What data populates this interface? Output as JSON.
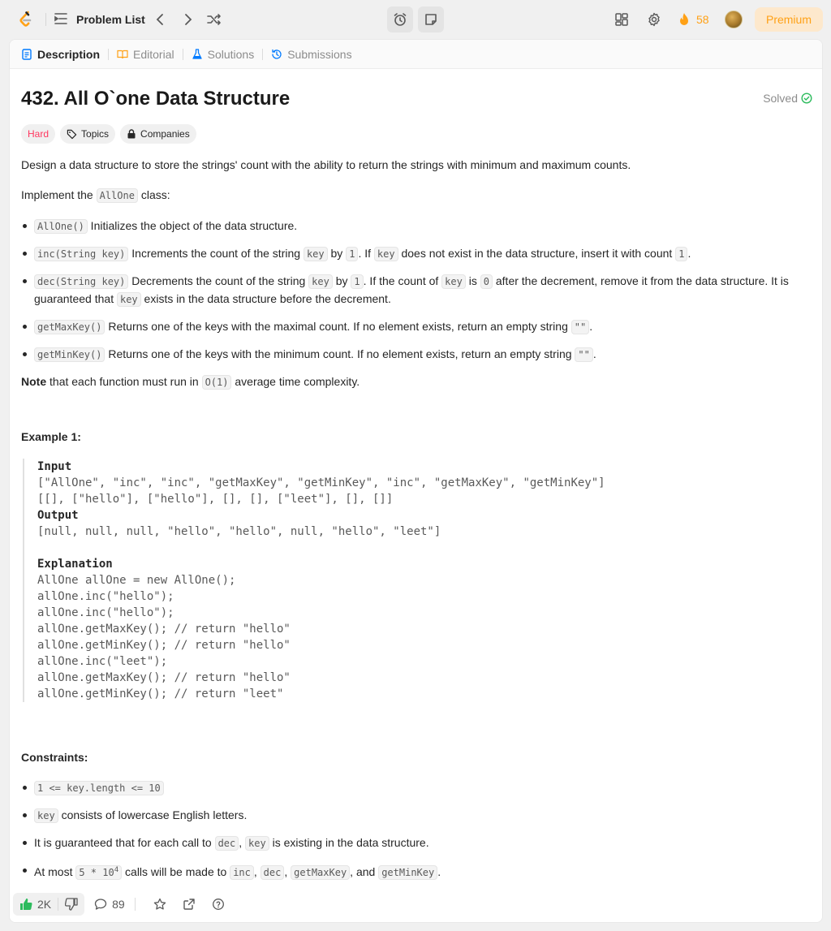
{
  "topbar": {
    "problem_list_label": "Problem List",
    "streak_count": "58",
    "premium_label": "Premium"
  },
  "tabs": [
    {
      "label": "Description"
    },
    {
      "label": "Editorial"
    },
    {
      "label": "Solutions"
    },
    {
      "label": "Submissions"
    }
  ],
  "problem": {
    "title": "432. All O`one Data Structure",
    "status": "Solved",
    "difficulty": "Hard",
    "topics_label": "Topics",
    "companies_label": "Companies",
    "intro": "Design a data structure to store the strings' count with the ability to return the strings with minimum and maximum counts.",
    "implement_prefix": "Implement the ",
    "implement_code": "AllOne",
    "implement_suffix": " class:",
    "methods": [
      {
        "code": "AllOne()",
        "text": " Initializes the object of the data structure."
      },
      {
        "code": "inc(String key)",
        "t1": " Increments the count of the string ",
        "c1": "key",
        "t2": " by ",
        "c2": "1",
        "t3": ". If ",
        "c3": "key",
        "t4": " does not exist in the data structure, insert it with count ",
        "c4": "1",
        "t5": "."
      },
      {
        "code": "dec(String key)",
        "t1": " Decrements the count of the string ",
        "c1": "key",
        "t2": " by ",
        "c2": "1",
        "t3": ". If the count of ",
        "c3": "key",
        "t4": " is ",
        "c4": "0",
        "t5": " after the decrement, remove it from the data structure. It is guaranteed that ",
        "c5": "key",
        "t6": " exists in the data structure before the decrement."
      },
      {
        "code": "getMaxKey()",
        "text": " Returns one of the keys with the maximal count. If no element exists, return an empty string ",
        "c1": "\"\"",
        "t2": "."
      },
      {
        "code": "getMinKey()",
        "text": " Returns one of the keys with the minimum count. If no element exists, return an empty string ",
        "c1": "\"\"",
        "t2": "."
      }
    ],
    "note_bold": "Note",
    "note_text": " that each function must run in ",
    "note_code": "O(1)",
    "note_suffix": " average time complexity."
  },
  "example": {
    "title": "Example 1:",
    "input_label": "Input",
    "input_line1": "[\"AllOne\", \"inc\", \"inc\", \"getMaxKey\", \"getMinKey\", \"inc\", \"getMaxKey\", \"getMinKey\"]",
    "input_line2": "[[], [\"hello\"], [\"hello\"], [], [], [\"leet\"], [], []]",
    "output_label": "Output",
    "output_line": "[null, null, null, \"hello\", \"hello\", null, \"hello\", \"leet\"]",
    "explanation_label": "Explanation",
    "explanation_lines": [
      "AllOne allOne = new AllOne();",
      "allOne.inc(\"hello\");",
      "allOne.inc(\"hello\");",
      "allOne.getMaxKey(); // return \"hello\"",
      "allOne.getMinKey(); // return \"hello\"",
      "allOne.inc(\"leet\");",
      "allOne.getMaxKey(); // return \"hello\"",
      "allOne.getMinKey(); // return \"leet\""
    ]
  },
  "constraints": {
    "title": "Constraints:",
    "c1_code": "1 <= key.length <= 10",
    "c2_code": "key",
    "c2_text": " consists of lowercase English letters.",
    "c3_text1": "It is guaranteed that for each call to ",
    "c3_code1": "dec",
    "c3_text2": ", ",
    "c3_code2": "key",
    "c3_text3": " is existing in the data structure.",
    "c4_text1": "At most ",
    "c4_code1_base": "5 * 10",
    "c4_code1_exp": "4",
    "c4_text2": " calls will be made to ",
    "c4_code2": "inc",
    "c4_sep1": ", ",
    "c4_code3": "dec",
    "c4_sep2": ", ",
    "c4_code4": "getMaxKey",
    "c4_sep3": ", and ",
    "c4_code5": "getMinKey",
    "c4_end": "."
  },
  "bottombar": {
    "likes": "2K",
    "comments": "89"
  },
  "colors": {
    "accent": "#ffa116",
    "hard": "#ff375f",
    "solved": "#2cbb5d",
    "like": "#2cbb5d"
  }
}
